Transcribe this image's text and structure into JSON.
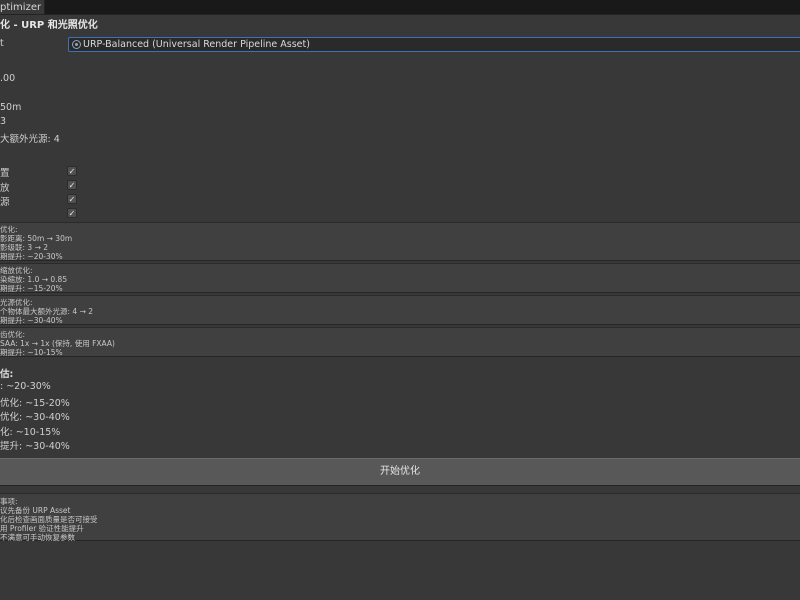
{
  "window": {
    "tab_label": "ptimizer",
    "title": "化 - URP 和光照优化"
  },
  "settings": {
    "asset_label": "t",
    "asset_value": "URP-Balanced (Universal Render Pipeline Asset)",
    "asset_icon": "render-pipeline-asset-icon",
    "values": [
      ".00",
      "50m",
      "3",
      "大额外光源: 4"
    ]
  },
  "toggles": [
    {
      "label": "置",
      "checked": true
    },
    {
      "label": "放",
      "checked": true
    },
    {
      "label": "源",
      "checked": true
    },
    {
      "label": "",
      "checked": true
    }
  ],
  "info_boxes": [
    {
      "lines": [
        "优化:",
        "影距离: 50m → 30m",
        "影级联: 3 → 2",
        "期提升: ~20-30%"
      ]
    },
    {
      "lines": [
        "缩放优化:",
        "染缩放: 1.0 → 0.85",
        "期提升: ~15-20%"
      ]
    },
    {
      "lines": [
        "光源优化:",
        "个物体最大额外光源: 4 → 2",
        "期提升: ~30-40%"
      ]
    },
    {
      "lines": [
        "齿优化:",
        "SAA: 1x → 1x (保持, 使用 FXAA)",
        "期提升: ~10-15%"
      ]
    }
  ],
  "estimates": {
    "title": "估:",
    "items": [
      ": ~20-30%",
      "优化: ~15-20%",
      "优化: ~30-40%",
      "化: ~10-15%",
      "提升: ~30-40%"
    ]
  },
  "actions": {
    "start_label": "开始优化"
  },
  "notes": {
    "lines": [
      "事项:",
      "议先备份 URP Asset",
      "化后检查画面质量是否可接受",
      "用 Profiler 验证性能提升",
      "不满意可手动恢复参数"
    ]
  },
  "colors": {
    "background": "#383838",
    "accent_border": "#3b72b8",
    "button": "#585858"
  }
}
